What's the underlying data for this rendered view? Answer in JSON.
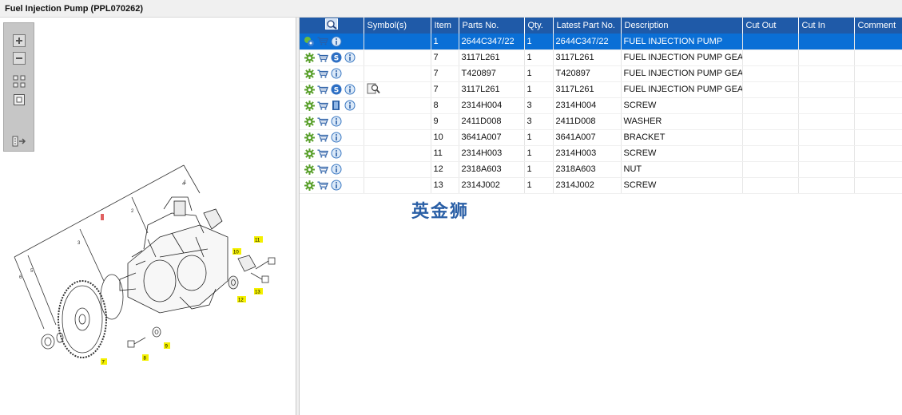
{
  "window": {
    "title": "Fuel Injection Pump (PPL070262)"
  },
  "toolbar": {
    "tools": [
      "zoom-in-icon",
      "zoom-out-icon",
      "fit-all-icon",
      "fit-window-icon",
      "export-icon"
    ]
  },
  "grid": {
    "columns": [
      "",
      "Symbol(s)",
      "Item",
      "Parts No.",
      "Qty.",
      "Latest Part No.",
      "Description",
      "Cut Out",
      "Cut In",
      "Comment"
    ],
    "rows": [
      {
        "icons": [
          "assembly-icon",
          "cart-icon",
          "info-icon"
        ],
        "symbol": "",
        "item": "1",
        "part": "2644C347/22",
        "qty": "1",
        "latest": "2644C347/22",
        "desc": "FUEL INJECTION PUMP",
        "selected": true
      },
      {
        "icons": [
          "gear-icon",
          "cart-icon",
          "s-badge-icon",
          "info-icon"
        ],
        "symbol": "",
        "item": "7",
        "part": "3117L261",
        "qty": "1",
        "latest": "3117L261",
        "desc": "FUEL INJECTION PUMP GEAR",
        "selected": false
      },
      {
        "icons": [
          "gear-icon",
          "cart-icon",
          "info-icon"
        ],
        "symbol": "",
        "item": "7",
        "part": "T420897",
        "qty": "1",
        "latest": "T420897",
        "desc": "FUEL INJECTION PUMP GEAR",
        "selected": false
      },
      {
        "icons": [
          "gear-icon",
          "cart-icon",
          "s-badge-icon",
          "info-icon"
        ],
        "symbol": "magnifier-doc-icon",
        "item": "7",
        "part": "3117L261",
        "qty": "1",
        "latest": "3117L261",
        "desc": "FUEL INJECTION PUMP GEAR",
        "selected": false
      },
      {
        "icons": [
          "gear-icon",
          "cart-icon",
          "book-icon",
          "info-icon"
        ],
        "symbol": "",
        "item": "8",
        "part": "2314H004",
        "qty": "3",
        "latest": "2314H004",
        "desc": "SCREW",
        "selected": false
      },
      {
        "icons": [
          "gear-icon",
          "cart-icon",
          "info-icon"
        ],
        "symbol": "",
        "item": "9",
        "part": "2411D008",
        "qty": "3",
        "latest": "2411D008",
        "desc": "WASHER",
        "selected": false
      },
      {
        "icons": [
          "gear-icon",
          "cart-icon",
          "info-icon"
        ],
        "symbol": "",
        "item": "10",
        "part": "3641A007",
        "qty": "1",
        "latest": "3641A007",
        "desc": "BRACKET",
        "selected": false
      },
      {
        "icons": [
          "gear-icon",
          "cart-icon",
          "info-icon"
        ],
        "symbol": "",
        "item": "11",
        "part": "2314H003",
        "qty": "1",
        "latest": "2314H003",
        "desc": "SCREW",
        "selected": false
      },
      {
        "icons": [
          "gear-icon",
          "cart-icon",
          "info-icon"
        ],
        "symbol": "",
        "item": "12",
        "part": "2318A603",
        "qty": "1",
        "latest": "2318A603",
        "desc": "NUT",
        "selected": false
      },
      {
        "icons": [
          "gear-icon",
          "cart-icon",
          "info-icon"
        ],
        "symbol": "",
        "item": "13",
        "part": "2314J002",
        "qty": "1",
        "latest": "2314J002",
        "desc": "SCREW",
        "selected": false
      }
    ]
  },
  "watermark": "英金狮",
  "diagram": {
    "callouts": [
      "1",
      "2",
      "3",
      "4",
      "5",
      "6",
      "7",
      "8",
      "9",
      "10",
      "11",
      "12",
      "13"
    ]
  },
  "colors": {
    "header": "#1f5aa8",
    "selected": "#0a6fd6",
    "callout": "#f4f000"
  }
}
